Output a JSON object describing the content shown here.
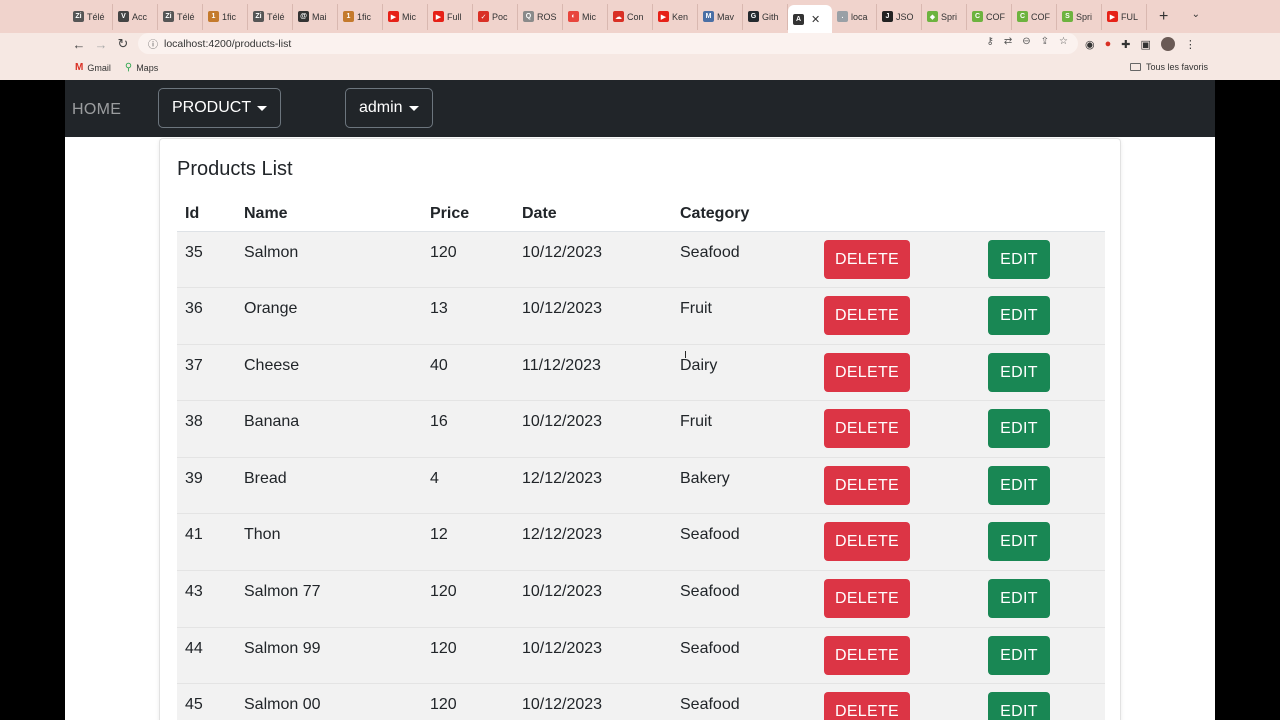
{
  "browser": {
    "tabs": [
      {
        "label": "Télé",
        "color": "#555555",
        "glyph": "Zi"
      },
      {
        "label": "Acc",
        "color": "#444444",
        "glyph": "V"
      },
      {
        "label": "Télé",
        "color": "#555555",
        "glyph": "Zi"
      },
      {
        "label": "1fic",
        "color": "#c47a2c",
        "glyph": "1"
      },
      {
        "label": "Télé",
        "color": "#555555",
        "glyph": "Zi"
      },
      {
        "label": "Mai",
        "color": "#333333",
        "glyph": "@"
      },
      {
        "label": "1fic",
        "color": "#c47a2c",
        "glyph": "1"
      },
      {
        "label": "Mic",
        "color": "#e62117",
        "glyph": "▶"
      },
      {
        "label": "Full",
        "color": "#e62117",
        "glyph": "▶"
      },
      {
        "label": "Poc",
        "color": "#d93025",
        "glyph": "✓"
      },
      {
        "label": "ROS",
        "color": "#8a8a8a",
        "glyph": "Q"
      },
      {
        "label": "Mic",
        "color": "#e8453c",
        "glyph": "◐"
      },
      {
        "label": "Con",
        "color": "#d93025",
        "glyph": "☁"
      },
      {
        "label": "Ken",
        "color": "#e62117",
        "glyph": "▶"
      },
      {
        "label": "Mav",
        "color": "#4a6fa5",
        "glyph": "M"
      },
      {
        "label": "Gith",
        "color": "#24292e",
        "glyph": "G"
      },
      {
        "label": "",
        "color": "#333333",
        "glyph": "A",
        "active": true
      },
      {
        "label": "loca",
        "color": "#9aa0a6",
        "glyph": "."
      },
      {
        "label": "JSO",
        "color": "#222222",
        "glyph": "J"
      },
      {
        "label": "Spri",
        "color": "#6db33f",
        "glyph": "◆"
      },
      {
        "label": "COF",
        "color": "#6db33f",
        "glyph": "C"
      },
      {
        "label": "COF",
        "color": "#6db33f",
        "glyph": "C"
      },
      {
        "label": "Spri",
        "color": "#6db33f",
        "glyph": "S"
      },
      {
        "label": "FUL",
        "color": "#e62117",
        "glyph": "▶"
      }
    ],
    "url": "localhost:4200/products-list",
    "bookmarks": [
      {
        "label": "Gmail",
        "icon": "M"
      },
      {
        "label": "Maps",
        "icon": "📍"
      }
    ],
    "all_bookmarks": "Tous les favoris"
  },
  "app": {
    "nav": {
      "home": "HOME",
      "product": "PRODUCT",
      "user": "admin"
    },
    "title": "Products List",
    "columns": [
      "Id",
      "Name",
      "Price",
      "Date",
      "Category"
    ],
    "delete_label": "DELETE",
    "edit_label": "EDIT",
    "colors": {
      "navbar": "#212529",
      "delete": "#dc3545",
      "edit": "#198754"
    },
    "products": [
      {
        "id": "35",
        "name": "Salmon",
        "price": "120",
        "date": "10/12/2023",
        "category": "Seafood"
      },
      {
        "id": "36",
        "name": "Orange",
        "price": "13",
        "date": "10/12/2023",
        "category": "Fruit"
      },
      {
        "id": "37",
        "name": "Cheese",
        "price": "40",
        "date": "11/12/2023",
        "category": "Dairy"
      },
      {
        "id": "38",
        "name": "Banana",
        "price": "16",
        "date": "10/12/2023",
        "category": "Fruit"
      },
      {
        "id": "39",
        "name": "Bread",
        "price": "4",
        "date": "12/12/2023",
        "category": "Bakery"
      },
      {
        "id": "41",
        "name": "Thon",
        "price": "12",
        "date": "12/12/2023",
        "category": "Seafood"
      },
      {
        "id": "43",
        "name": "Salmon 77",
        "price": "120",
        "date": "10/12/2023",
        "category": "Seafood"
      },
      {
        "id": "44",
        "name": "Salmon 99",
        "price": "120",
        "date": "10/12/2023",
        "category": "Seafood"
      },
      {
        "id": "45",
        "name": "Salmon 00",
        "price": "120",
        "date": "10/12/2023",
        "category": "Seafood"
      }
    ]
  }
}
